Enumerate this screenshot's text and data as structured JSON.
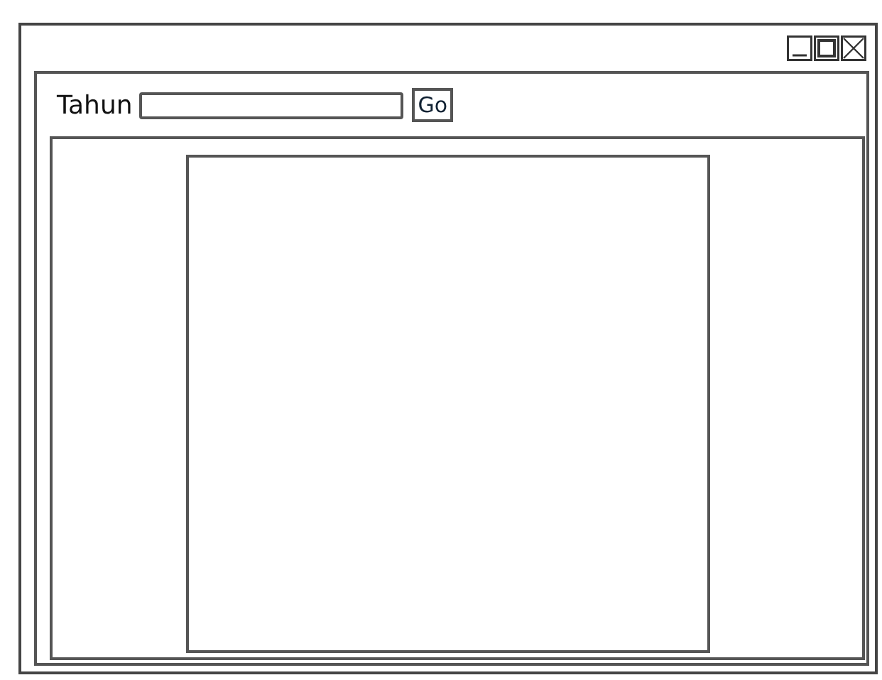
{
  "form": {
    "label": "Tahun",
    "button": "Go"
  }
}
